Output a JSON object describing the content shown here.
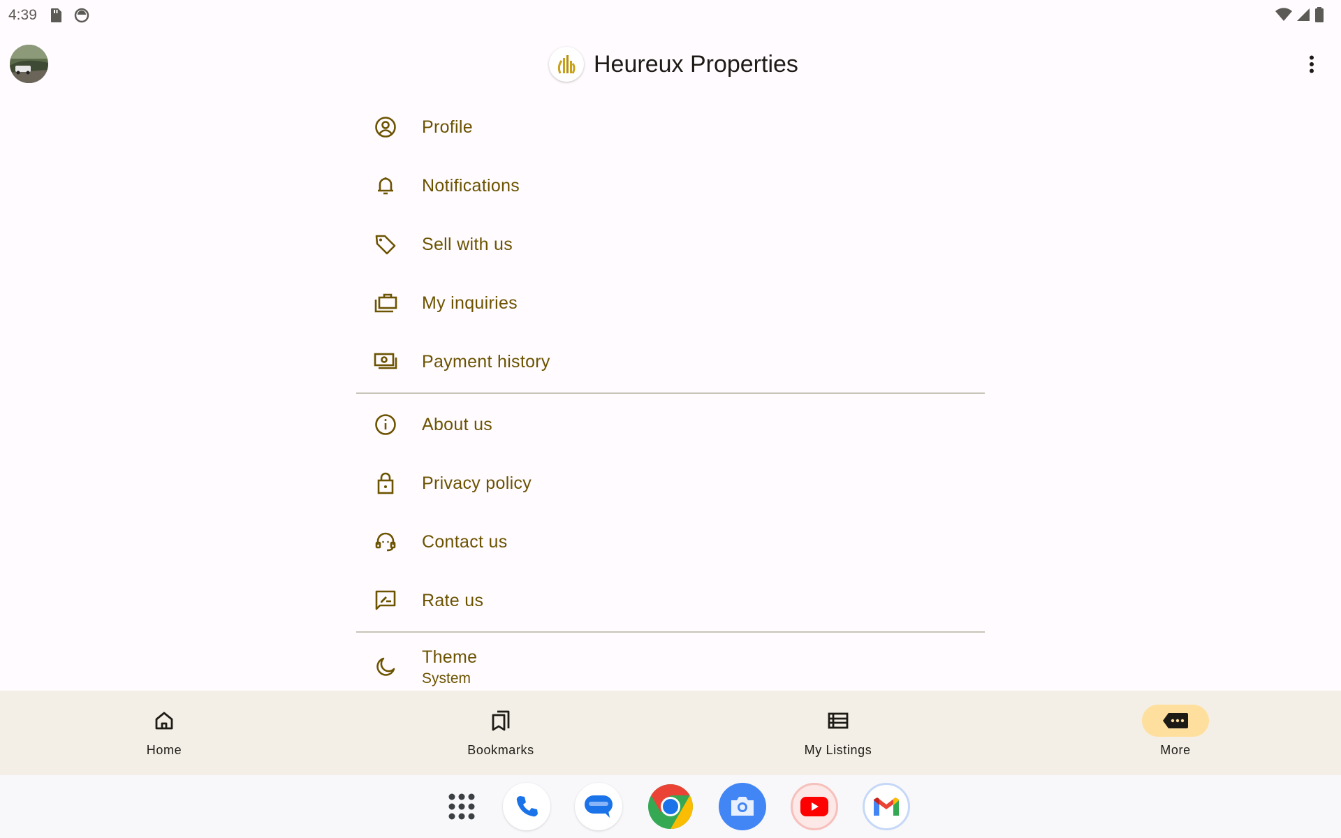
{
  "status_bar": {
    "time": "4:39",
    "icons": [
      "sd-card-icon",
      "sync-circle-icon",
      "wifi-icon",
      "signal-icon",
      "battery-icon"
    ]
  },
  "app_bar": {
    "title": "Heureux Properties",
    "avatar": "avatar",
    "overflow_icon": "more-vert-icon"
  },
  "menu": {
    "section1": [
      {
        "label": "Profile",
        "icon": "account-circle-icon"
      },
      {
        "label": "Notifications",
        "icon": "bell-icon"
      },
      {
        "label": "Sell with us",
        "icon": "tag-icon"
      },
      {
        "label": "My inquiries",
        "icon": "cases-icon"
      },
      {
        "label": "Payment history",
        "icon": "payments-icon"
      }
    ],
    "section2": [
      {
        "label": "About us",
        "icon": "info-icon"
      },
      {
        "label": "Privacy policy",
        "icon": "lock-icon"
      },
      {
        "label": "Contact us",
        "icon": "support-agent-icon"
      },
      {
        "label": "Rate us",
        "icon": "rate-review-icon"
      }
    ],
    "theme": {
      "label": "Theme",
      "value": "System",
      "icon": "moon-icon"
    }
  },
  "bottom_nav": {
    "items": [
      {
        "label": "Home",
        "icon": "home-icon",
        "active": false
      },
      {
        "label": "Bookmarks",
        "icon": "bookmarks-icon",
        "active": false
      },
      {
        "label": "My Listings",
        "icon": "list-icon",
        "active": false
      },
      {
        "label": "More",
        "icon": "more-label-icon",
        "active": true
      }
    ]
  },
  "dock": {
    "apps": [
      "app-drawer-icon",
      "phone-icon",
      "messages-icon",
      "chrome-icon",
      "camera-icon",
      "youtube-icon",
      "gmail-icon"
    ]
  },
  "colors": {
    "accent": "#6b5300",
    "nav_active": "#ffdf9e",
    "nav_background": "#f3efe6",
    "background": "#fffbff"
  }
}
